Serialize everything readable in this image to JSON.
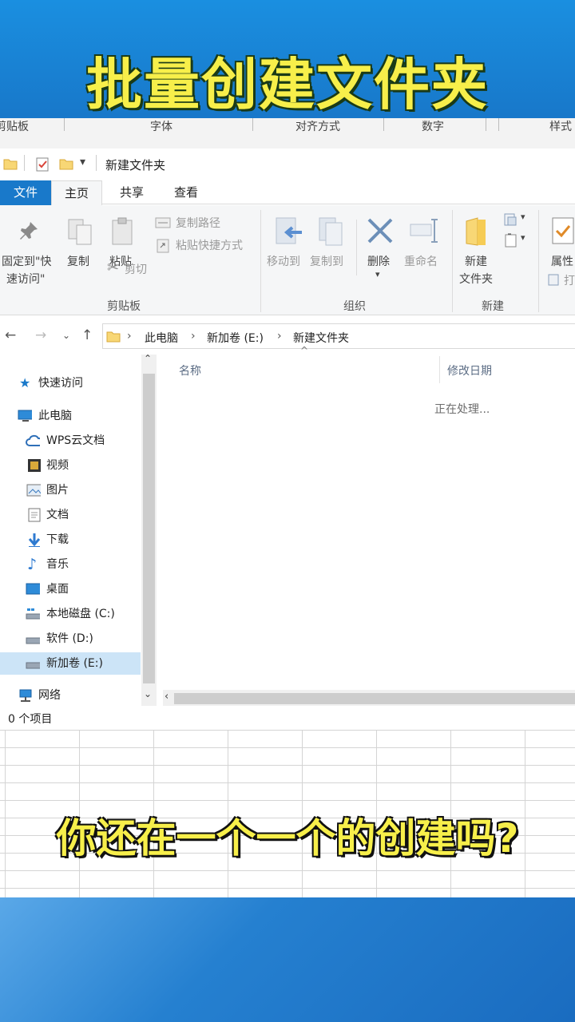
{
  "banner": {
    "title": "批量创建文件夹"
  },
  "excel_strip": {
    "labels": [
      "剪贴板",
      "字体",
      "对齐方式",
      "数字",
      "样式"
    ]
  },
  "explorer": {
    "window_title": "新建文件夹",
    "tabs": {
      "file": "文件",
      "home": "主页",
      "share": "共享",
      "view": "查看"
    },
    "ribbon": {
      "pin_line1": "固定到\"快",
      "pin_line2": "速访问\"",
      "copy": "复制",
      "paste": "粘贴",
      "copy_path": "复制路径",
      "paste_shortcut": "粘贴快捷方式",
      "cut": "剪切",
      "group_clipboard": "剪贴板",
      "move_to": "移动到",
      "copy_to": "复制到",
      "delete": "删除",
      "rename": "重命名",
      "group_organize": "组织",
      "new_folder_line1": "新建",
      "new_folder_line2": "文件夹",
      "group_new": "新建",
      "properties": "属性",
      "open_partial": "打"
    },
    "address": {
      "this_pc": "此电脑",
      "volume": "新加卷 (E:)",
      "folder": "新建文件夹"
    },
    "nav": {
      "quick_access": "快速访问",
      "this_pc": "此电脑",
      "wps_cloud": "WPS云文档",
      "videos": "视频",
      "pictures": "图片",
      "documents": "文档",
      "downloads": "下载",
      "music": "音乐",
      "desktop": "桌面",
      "drive_c": "本地磁盘 (C:)",
      "drive_d": "软件 (D:)",
      "drive_e": "新加卷 (E:)",
      "network": "网络"
    },
    "columns": {
      "name": "名称",
      "modified": "修改日期"
    },
    "processing": "正在处理...",
    "status": "0 个项目"
  },
  "subtitle": "你还在一个一个的创建吗?",
  "colors": {
    "accent": "#1979ca",
    "banner_text": "#f7ef4a",
    "banner_bg": "#1a8fe0"
  }
}
